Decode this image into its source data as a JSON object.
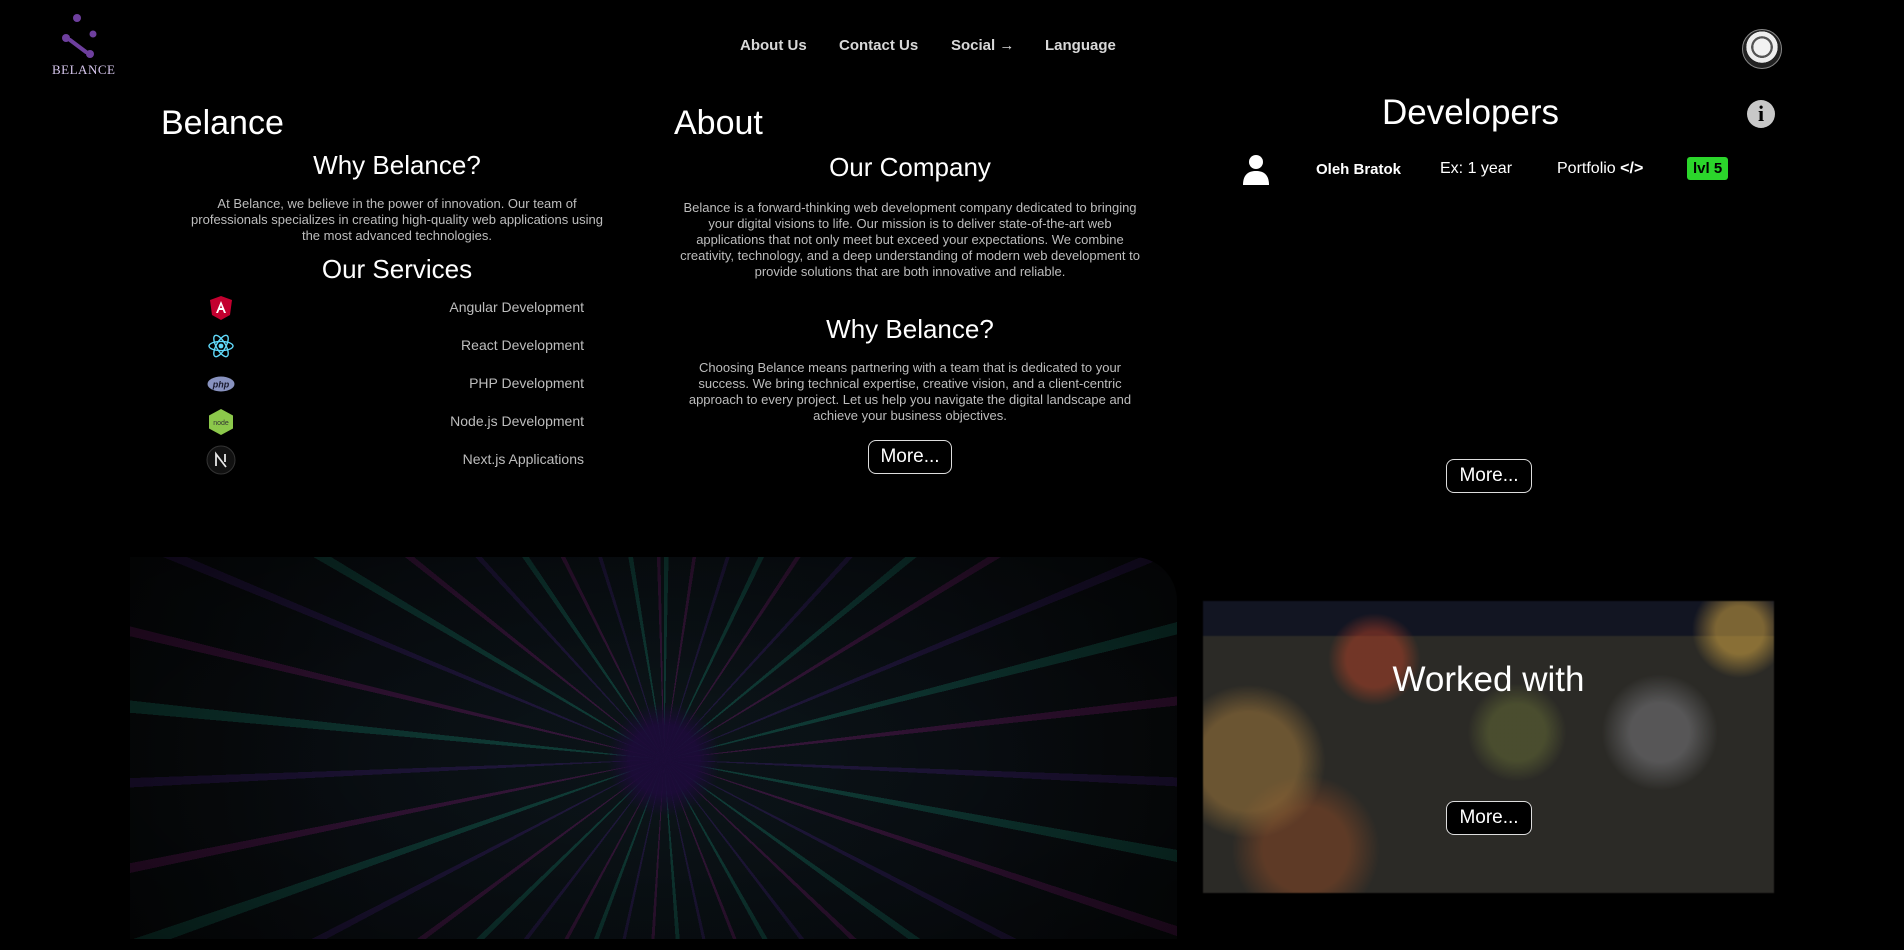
{
  "header": {
    "logo_text": "BELANCE",
    "nav": [
      "About Us",
      "Contact Us",
      "Social",
      "Language"
    ],
    "social_arrow": "→"
  },
  "belance": {
    "title": "Belance",
    "why_title": "Why Belance?",
    "why_text": "At Belance, we believe in the power of innovation. Our team of professionals specializes in creating high-quality web applications using the most advanced technologies.",
    "services_title": "Our Services",
    "services": [
      {
        "label": "Angular Development",
        "icon": "angular-icon"
      },
      {
        "label": "React Development",
        "icon": "react-icon"
      },
      {
        "label": "PHP Development",
        "icon": "php-icon"
      },
      {
        "label": "Node.js Development",
        "icon": "nodejs-icon"
      },
      {
        "label": "Next.js Applications",
        "icon": "nextjs-icon"
      }
    ]
  },
  "about": {
    "title": "About",
    "company_title": "Our Company",
    "company_text": "Belance is a forward-thinking web development company dedicated to bringing your digital visions to life. Our mission is to deliver state-of-the-art web applications that not only meet but exceed your expectations. We combine creativity, technology, and a deep understanding of modern web development to provide solutions that are both innovative and reliable.",
    "why_title": "Why Belance?",
    "why_text": "Choosing Belance means partnering with a team that is dedicated to your success. We bring technical expertise, creative vision, and a client-centric approach to every project. Let us help you navigate the digital landscape and achieve your business objectives.",
    "more": "More..."
  },
  "developers": {
    "title": "Developers",
    "info_icon": "i",
    "list": [
      {
        "name": "Oleh Bratok",
        "experience": "Ex: 1 year",
        "portfolio": "Portfolio",
        "code_icon": "</>",
        "level": "lvl 5"
      }
    ],
    "more": "More..."
  },
  "worked_with": {
    "title": "Worked with",
    "more": "More..."
  },
  "colors": {
    "accent_purple": "#6e3f9e",
    "level_green": "#2bd62b",
    "angular_red": "#c3002f",
    "react_cyan": "#61dafb",
    "node_green": "#8cc84b"
  }
}
